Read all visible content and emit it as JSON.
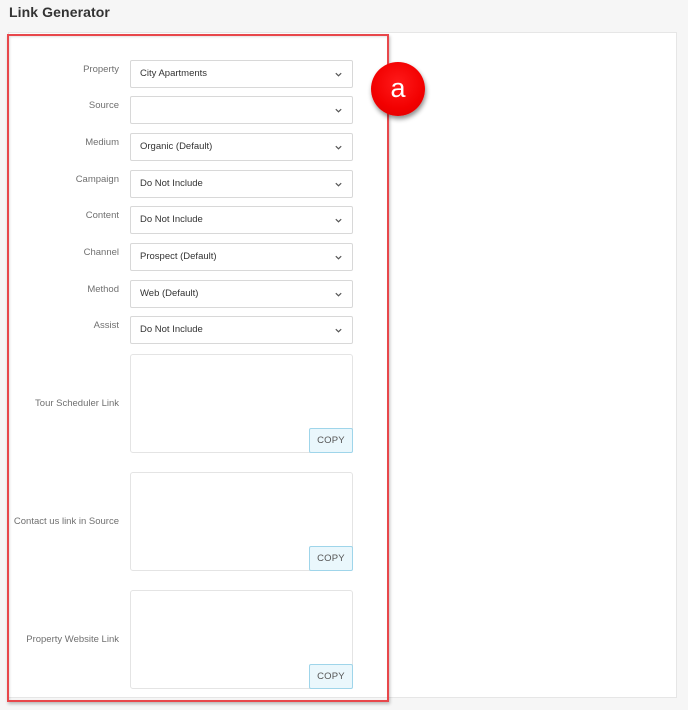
{
  "header": {
    "title": "Link Generator"
  },
  "callout": {
    "label": "a",
    "color": "#f20000"
  },
  "highlight_color": "#e8474b",
  "form": {
    "fields": [
      {
        "label": "Property",
        "value": "City Apartments"
      },
      {
        "label": "Source",
        "value": ""
      },
      {
        "label": "Medium",
        "value": "Organic (Default)"
      },
      {
        "label": "Campaign",
        "value": "Do Not Include"
      },
      {
        "label": "Content",
        "value": "Do Not Include"
      },
      {
        "label": "Channel",
        "value": "Prospect (Default)"
      },
      {
        "label": "Method",
        "value": "Web (Default)"
      },
      {
        "label": "Assist",
        "value": "Do Not Include"
      }
    ],
    "links": [
      {
        "label": "Tour Scheduler Link",
        "value": "",
        "button": "COPY"
      },
      {
        "label": "Contact us link in Source",
        "value": "",
        "button": "COPY"
      },
      {
        "label": "Property Website Link",
        "value": "",
        "button": "COPY"
      }
    ]
  },
  "icons": {
    "select_arrow": "chevron-down-icon"
  }
}
